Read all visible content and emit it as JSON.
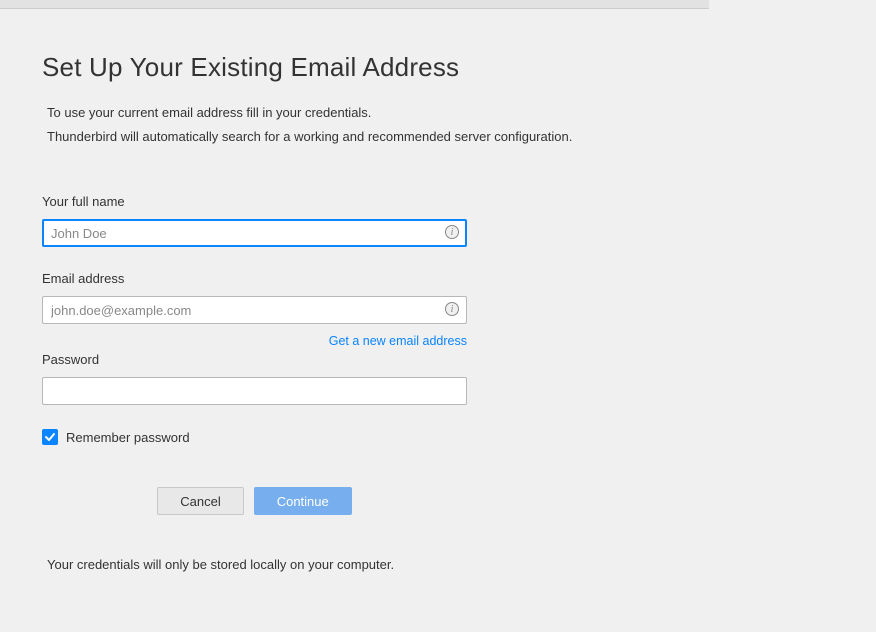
{
  "heading": "Set Up Your Existing Email Address",
  "intro": {
    "line1": "To use your current email address fill in your credentials.",
    "line2": "Thunderbird will automatically search for a working and recommended server configuration."
  },
  "form": {
    "full_name": {
      "label": "Your full name",
      "placeholder": "John Doe",
      "value": ""
    },
    "email": {
      "label": "Email address",
      "placeholder": "john.doe@example.com",
      "value": ""
    },
    "new_email_link": "Get a new email address",
    "password": {
      "label": "Password",
      "value": ""
    },
    "remember": {
      "label": "Remember password",
      "checked": true
    }
  },
  "buttons": {
    "cancel": "Cancel",
    "continue": "Continue"
  },
  "footer_note": "Your credentials will only be stored locally on your computer."
}
